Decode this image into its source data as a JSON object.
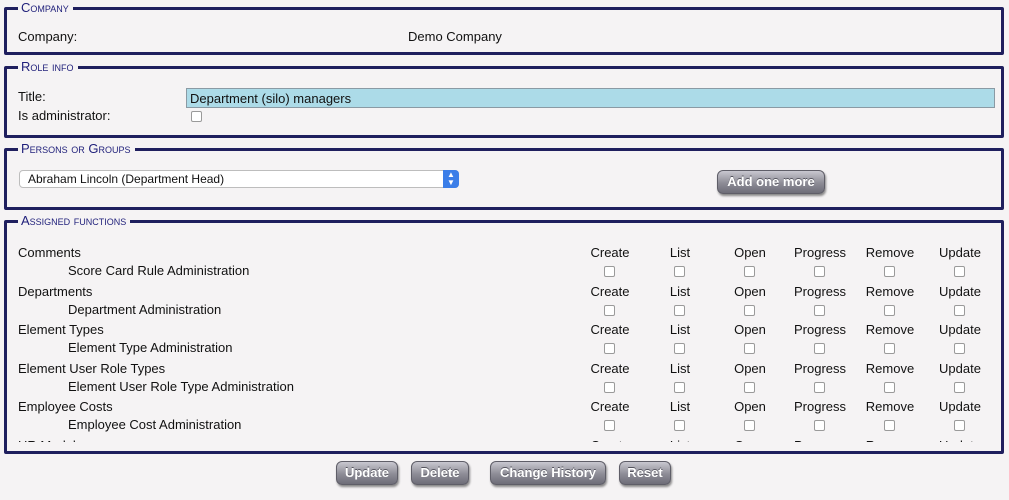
{
  "company": {
    "legend": "Company",
    "label": "Company:",
    "value": "Demo Company"
  },
  "role": {
    "legend": "Role info",
    "title_label": "Title:",
    "title_value": "Department (silo) managers",
    "admin_label": "Is administrator:",
    "admin_checked": false
  },
  "persons": {
    "legend": "Persons or Groups",
    "selected": "Abraham Lincoln (Department Head)",
    "add_button": "Add one more"
  },
  "functions": {
    "legend": "Assigned functions",
    "columns": [
      "Create",
      "List",
      "Open",
      "Progress",
      "Remove",
      "Update"
    ],
    "groups": [
      {
        "name": "Comments",
        "sub": "Score Card Rule Administration"
      },
      {
        "name": "Departments",
        "sub": "Department Administration"
      },
      {
        "name": "Element Types",
        "sub": "Element Type Administration"
      },
      {
        "name": "Element User Role Types",
        "sub": "Element User Role Type Administration"
      },
      {
        "name": "Employee Costs",
        "sub": "Employee Cost Administration"
      },
      {
        "name": "HR Module",
        "sub": ""
      }
    ]
  },
  "actions": {
    "update": "Update",
    "delete": "Delete",
    "history": "Change History",
    "reset": "Reset"
  },
  "colors": {
    "border": "#1f1f5e",
    "legend_text": "#1f1f7a",
    "title_field_bg": "#acdbe8",
    "background": "#f5f3f4"
  }
}
